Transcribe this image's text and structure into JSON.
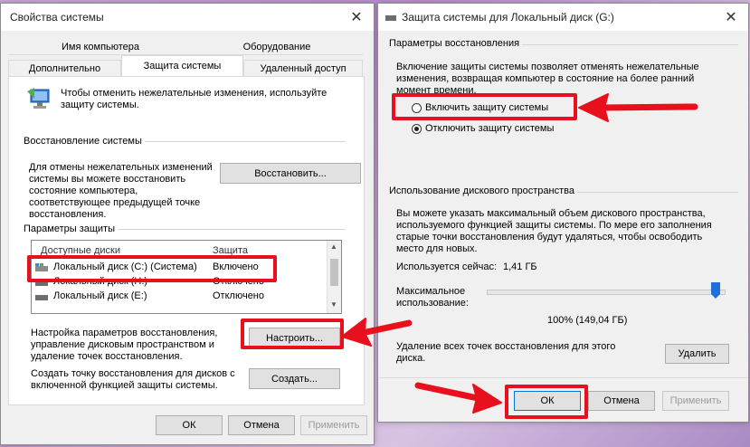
{
  "win1": {
    "title": "Свойства системы",
    "tabs_top": [
      "Имя компьютера",
      "Оборудование"
    ],
    "tabs_bottom": [
      "Дополнительно",
      "Защита системы",
      "Удаленный доступ"
    ],
    "intro": "Чтобы отменить нежелательные изменения, используйте защиту системы.",
    "restore_group": "Восстановление системы",
    "restore_text": "Для отмены нежелательных изменений системы вы можете восстановить состояние компьютера, соответствующее предыдущей точке восстановления.",
    "restore_button": "Восстановить...",
    "protection_group": "Параметры защиты",
    "list_headers": [
      "Доступные диски",
      "Защита"
    ],
    "drives": [
      {
        "name": "Локальный диск (C:) (Система)",
        "status": "Включено"
      },
      {
        "name": "Локальный диск (H:)",
        "status": "Отключено"
      },
      {
        "name": "Локальный диск (E:)",
        "status": "Отключено"
      }
    ],
    "configure_text": "Настройка параметров восстановления, управление дисковым пространством и удаление точек восстановления.",
    "configure_button": "Настроить...",
    "create_text": "Создать точку восстановления для дисков с включенной функцией защиты системы.",
    "create_button": "Создать...",
    "ok": "ОК",
    "cancel": "Отмена",
    "apply": "Применить"
  },
  "win2": {
    "title": "Защита системы для Локальный диск (G:)",
    "restore_params_group": "Параметры восстановления",
    "restore_params_text": "Включение защиты системы позволяет отменять нежелательные изменения, возвращая компьютер в состояние на более ранний момент времени.",
    "radio_enable": "Включить защиту системы",
    "radio_disable": "Отключить защиту системы",
    "disk_usage_group": "Использование дискового пространства",
    "disk_usage_text": "Вы можете указать максимальный объем дискового пространства, используемого функцией защиты системы. По мере его заполнения старые точки восстановления будут удаляться, чтобы освободить место для новых.",
    "current_usage_label": "Используется сейчас:",
    "current_usage_value": "1,41 ГБ",
    "max_usage_label": "Максимальное использование:",
    "slider_value_percent": 100,
    "slider_value_text": "100% (149,04 ГБ)",
    "delete_text": "Удаление всех точек восстановления для этого диска.",
    "delete_button": "Удалить",
    "ok": "ОК",
    "cancel": "Отмена",
    "apply": "Применить"
  },
  "colors": {
    "highlight_red": "#e8101c",
    "slider_thumb": "#1e6fd9",
    "window_bg": "#f0f0f0"
  }
}
